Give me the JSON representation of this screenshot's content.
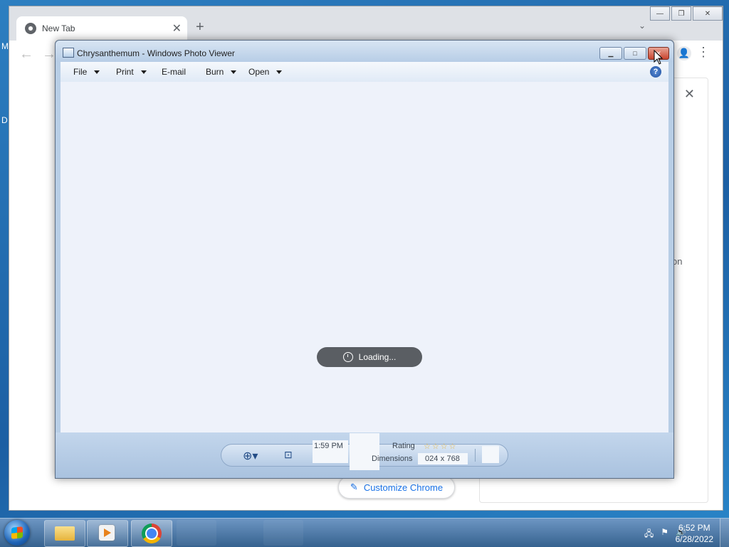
{
  "desktop": {
    "left_chars": [
      "M",
      "D"
    ]
  },
  "chrome": {
    "tab_title": "New Tab",
    "tab_close": "✕",
    "new_tab": "+",
    "tab_search": "⌄",
    "back": "←",
    "forward": "→",
    "profile": "👤",
    "menu": "⋮",
    "side_close": "✕",
    "side_fragment": "on",
    "customize_label": "Customize Chrome",
    "customize_icon": "✎"
  },
  "photo_viewer": {
    "title": "Chrysanthemum - Windows Photo Viewer",
    "menu": [
      {
        "label": "File",
        "has_dropdown": true
      },
      {
        "label": "Print",
        "has_dropdown": true
      },
      {
        "label": "E-mail",
        "has_dropdown": false
      },
      {
        "label": "Burn",
        "has_dropdown": true
      },
      {
        "label": "Open",
        "has_dropdown": true
      }
    ],
    "help": "?",
    "loading_text": "Loading...",
    "info": {
      "time": "1:59 PM",
      "rating_label": "Rating",
      "dimensions_label": "Dimensions",
      "dimensions_value_a": "024",
      "dimensions_value_b": "x",
      "dimensions_value_c": "768"
    },
    "stars": "☆☆☆☆",
    "zoom_icon": "⊕▾",
    "fit_icon": "⊡"
  },
  "taskbar": {
    "time": "6:52 PM",
    "date": "6/28/2022",
    "tray_icons": [
      "network-icon",
      "action-center-icon",
      "volume-icon"
    ],
    "tray_glyphs": [
      "🖧",
      "⚑",
      "🔊"
    ]
  },
  "colors": {
    "desktop": "#2d7fc1",
    "close_red": "#c9442e",
    "loading_bg": "#5a5e63",
    "chrome_link": "#1a73e8"
  }
}
